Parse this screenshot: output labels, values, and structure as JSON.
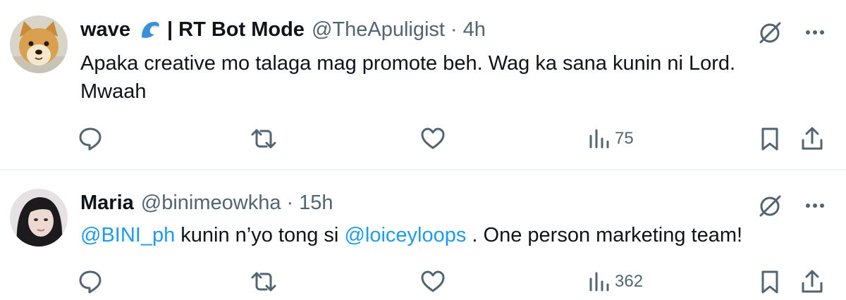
{
  "tweets": [
    {
      "display_name": "wave",
      "name_suffix": "| RT Bot Mode",
      "handle": "@TheApuligist",
      "separator": "·",
      "time": "4h",
      "body_line1": "Apaka creative mo talaga mag promote beh. Wag ka sana kunin ni Lord.",
      "body_line2": "Mwaah",
      "views": "75",
      "avatar": "shiba-dog-avatar",
      "name_emoji": "wave-emoji"
    },
    {
      "display_name": "Maria",
      "handle": "@binimeowkha",
      "separator": "·",
      "time": "15h",
      "mention1": "@BINI_ph",
      "text_mid": " kunin n’yo tong si ",
      "mention2": "@loiceyloops",
      "text_end": " . One person marketing team!",
      "views": "362",
      "avatar": "woman-portrait-avatar"
    }
  ],
  "icons": {
    "reply": "reply-icon",
    "retweet": "retweet-icon",
    "like": "heart-icon",
    "views": "views-icon",
    "bookmark": "bookmark-icon",
    "share": "share-icon",
    "grok": "grok-icon",
    "more": "more-icon"
  },
  "colors": {
    "text": "#0f1419",
    "secondary": "#536471",
    "link": "#1d9bf0",
    "divider": "#eff3f4"
  }
}
